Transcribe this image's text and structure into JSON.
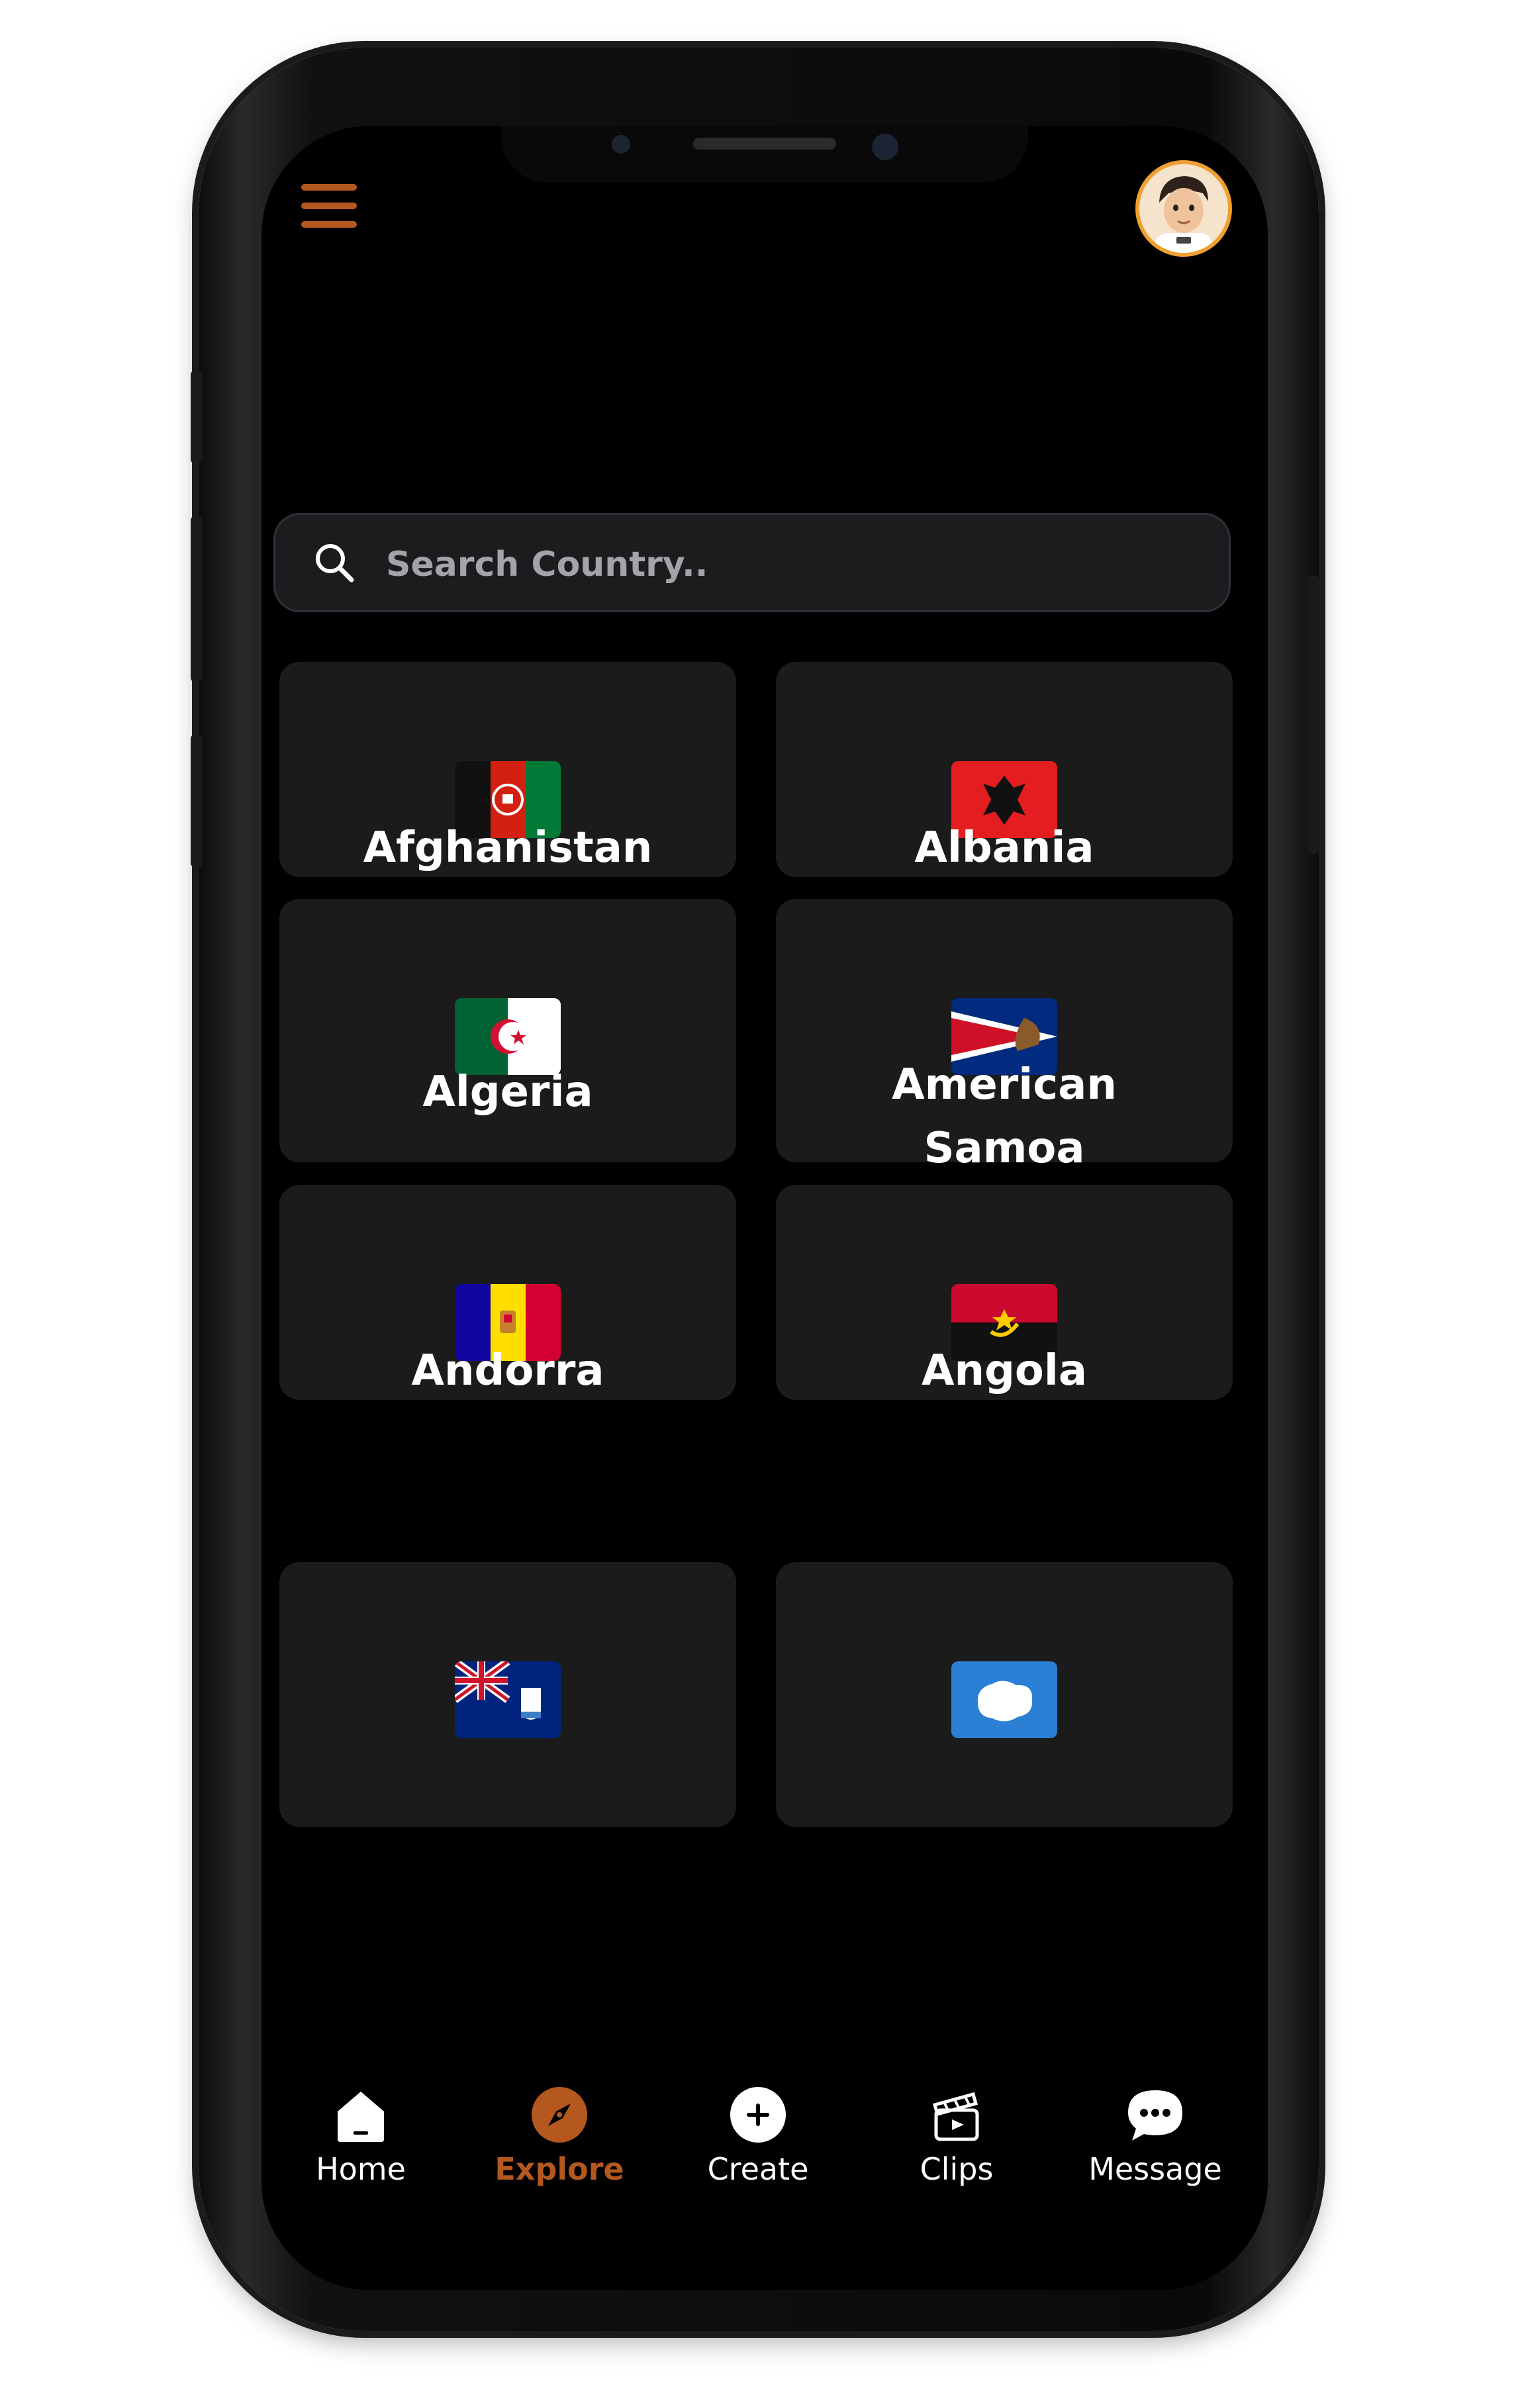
{
  "search": {
    "placeholder": "Search Country.."
  },
  "countries": [
    {
      "name": "Afghanistan",
      "flag": "flag-afghanistan"
    },
    {
      "name": "Albania",
      "flag": "flag-albania"
    },
    {
      "name": "Algeria",
      "flag": "flag-algeria"
    },
    {
      "name": "American Samoa",
      "flag": "flag-american-samoa"
    },
    {
      "name": "Andorra",
      "flag": "flag-andorra"
    },
    {
      "name": "Angola",
      "flag": "flag-angola"
    },
    {
      "name": "",
      "flag": "flag-anguilla"
    },
    {
      "name": "",
      "flag": "flag-antarctica"
    }
  ],
  "tabs": [
    {
      "label": "Home",
      "icon": "home-icon"
    },
    {
      "label": "Explore",
      "icon": "compass-icon",
      "active": true
    },
    {
      "label": "Create",
      "icon": "plus-circle-icon"
    },
    {
      "label": "Clips",
      "icon": "clapperboard-icon"
    },
    {
      "label": "Message",
      "icon": "chat-bubble-icon"
    }
  ],
  "colors": {
    "accent": "#b5581f",
    "background": "#000000",
    "card": "#1b1b1b",
    "search_bg": "#1c1c1f"
  }
}
